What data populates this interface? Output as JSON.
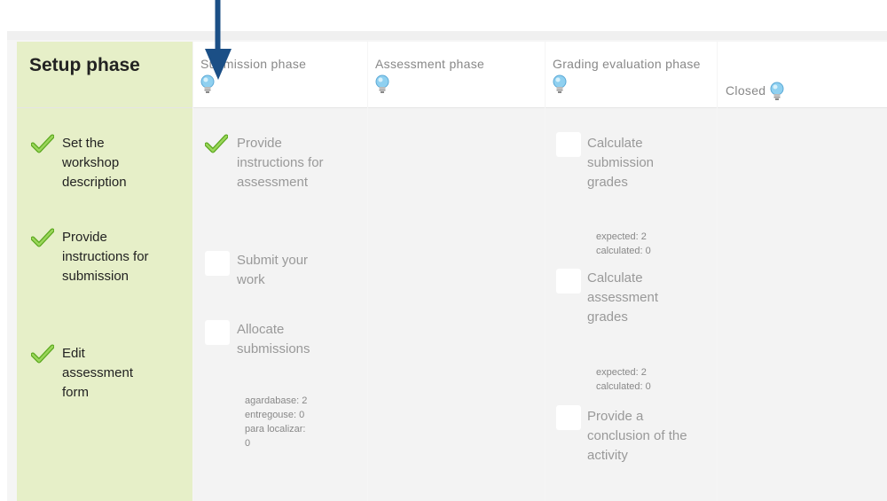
{
  "phases": {
    "setup": {
      "title": "Setup phase",
      "tasks": [
        {
          "label": "Set the workshop description",
          "done": true
        },
        {
          "label": "Provide instructions for submission",
          "done": true
        },
        {
          "label": "Edit assessment form",
          "done": true
        }
      ]
    },
    "submission": {
      "title": "Submission phase",
      "tasks": [
        {
          "label": "Provide instructions for assessment",
          "done": true
        },
        {
          "label": "Submit your work",
          "done": false
        },
        {
          "label": "Allocate submissions",
          "done": false
        }
      ],
      "info": [
        "agardabase: 2",
        "entregouse: 0",
        "para localizar:",
        "0"
      ]
    },
    "assessment": {
      "title": "Assessment phase"
    },
    "grading": {
      "title": "Grading evaluation phase",
      "tasks": [
        {
          "label": "Calculate submission grades",
          "info": [
            "expected: 2",
            "calculated: 0"
          ]
        },
        {
          "label": "Calculate assessment grades",
          "info": [
            "expected: 2",
            "calculated: 0"
          ]
        },
        {
          "label": "Provide a conclusion of the activity"
        }
      ]
    },
    "closed": {
      "title": "Closed"
    }
  },
  "icons": {
    "check": "check-icon",
    "bulb": "lightbulb-icon",
    "arrow": "down-arrow-icon"
  },
  "colors": {
    "active_phase": "#e6efc8",
    "inactive_phase": "#f3f3f3",
    "arrow": "#1b4f86",
    "check": "#7cc13a"
  }
}
